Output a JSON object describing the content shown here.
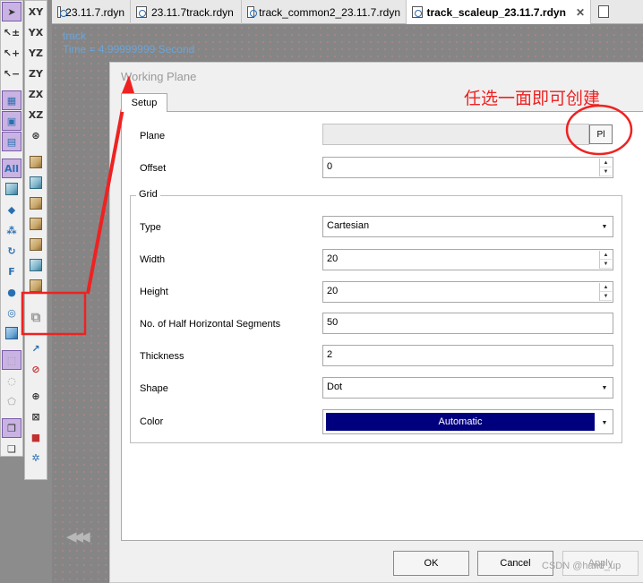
{
  "tabs": [
    {
      "label": "23.11.7.rdyn",
      "active": false
    },
    {
      "label": "23.11.7track.rdyn",
      "active": false
    },
    {
      "label": "track_common2_23.11.7.rdyn",
      "active": false
    },
    {
      "label": "track_scaleup_23.11.7.rdyn",
      "active": true
    }
  ],
  "canvas": {
    "model_name": "track",
    "time_label": "Time = 4.99999999 Second"
  },
  "toolbar_left": {
    "all_label": "All",
    "f_label": "F"
  },
  "toolbar_axes": [
    "XY",
    "YX",
    "YZ",
    "ZY",
    "ZX",
    "XZ"
  ],
  "dialog": {
    "title": "Working Plane",
    "tab_label": "Setup",
    "plane": {
      "label": "Plane",
      "value": "",
      "button": "Pl"
    },
    "offset": {
      "label": "Offset",
      "value": "0"
    },
    "grid": {
      "title": "Grid",
      "type": {
        "label": "Type",
        "value": "Cartesian"
      },
      "width": {
        "label": "Width",
        "value": "20"
      },
      "height": {
        "label": "Height",
        "value": "20"
      },
      "half_segments": {
        "label": "No. of Half Horizontal Segments",
        "value": "50"
      },
      "thickness": {
        "label": "Thickness",
        "value": "2"
      },
      "shape": {
        "label": "Shape",
        "value": "Dot"
      },
      "color": {
        "label": "Color",
        "value": "Automatic",
        "swatch": "#00007f"
      }
    },
    "buttons": {
      "ok": "OK",
      "cancel": "Cancel",
      "apply": "Apply"
    }
  },
  "annotation": {
    "text": "任选一面即可创建",
    "color": "#ee2222"
  },
  "watermark": "CSDN @hand_up"
}
